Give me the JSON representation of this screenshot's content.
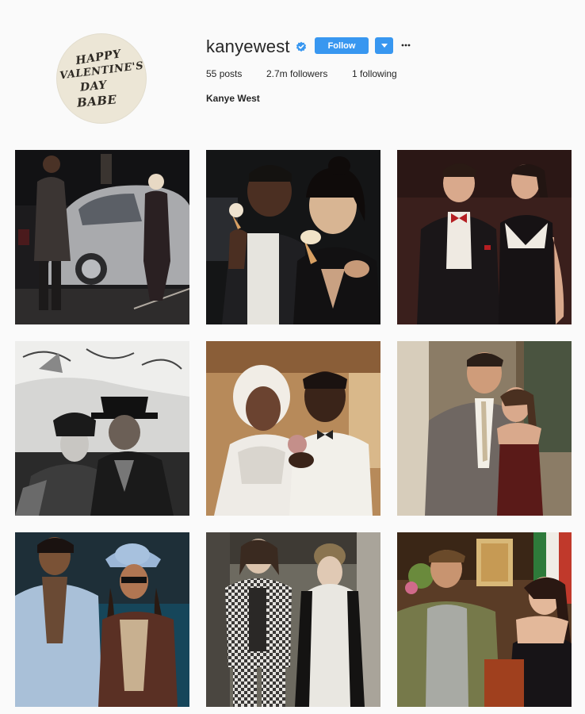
{
  "profile": {
    "avatar_text": [
      "HAPPY",
      "VALENTINE'S",
      "DAY",
      "BABE"
    ],
    "username": "kanyewest",
    "verified_icon": "verified-badge-icon",
    "follow_label": "Follow",
    "dropdown_icon": "caret-down-icon",
    "more_icon": "ellipsis-icon",
    "stats": {
      "posts_count": "55",
      "posts_label": "posts",
      "followers_count": "2.7m",
      "followers_label": "followers",
      "following_count": "1",
      "following_label": "following"
    },
    "full_name": "Kanye West"
  },
  "colors": {
    "accent": "#3897f0",
    "background": "#fafafa",
    "text": "#262626"
  },
  "posts": [
    {
      "row": 1,
      "col": 1,
      "description_icon": "photo-couple-car-night"
    },
    {
      "row": 1,
      "col": 2,
      "description_icon": "photo-couple-ice-cream"
    },
    {
      "row": 1,
      "col": 3,
      "description_icon": "photo-couple-formal"
    },
    {
      "row": 2,
      "col": 1,
      "description_icon": "photo-couple-bw"
    },
    {
      "row": 2,
      "col": 2,
      "description_icon": "photo-couple-wedding"
    },
    {
      "row": 2,
      "col": 3,
      "description_icon": "photo-couple-suit-gown"
    },
    {
      "row": 3,
      "col": 1,
      "description_icon": "photo-couple-hat"
    },
    {
      "row": 3,
      "col": 2,
      "description_icon": "photo-couple-checkered"
    },
    {
      "row": 3,
      "col": 3,
      "description_icon": "photo-couple-party"
    }
  ]
}
